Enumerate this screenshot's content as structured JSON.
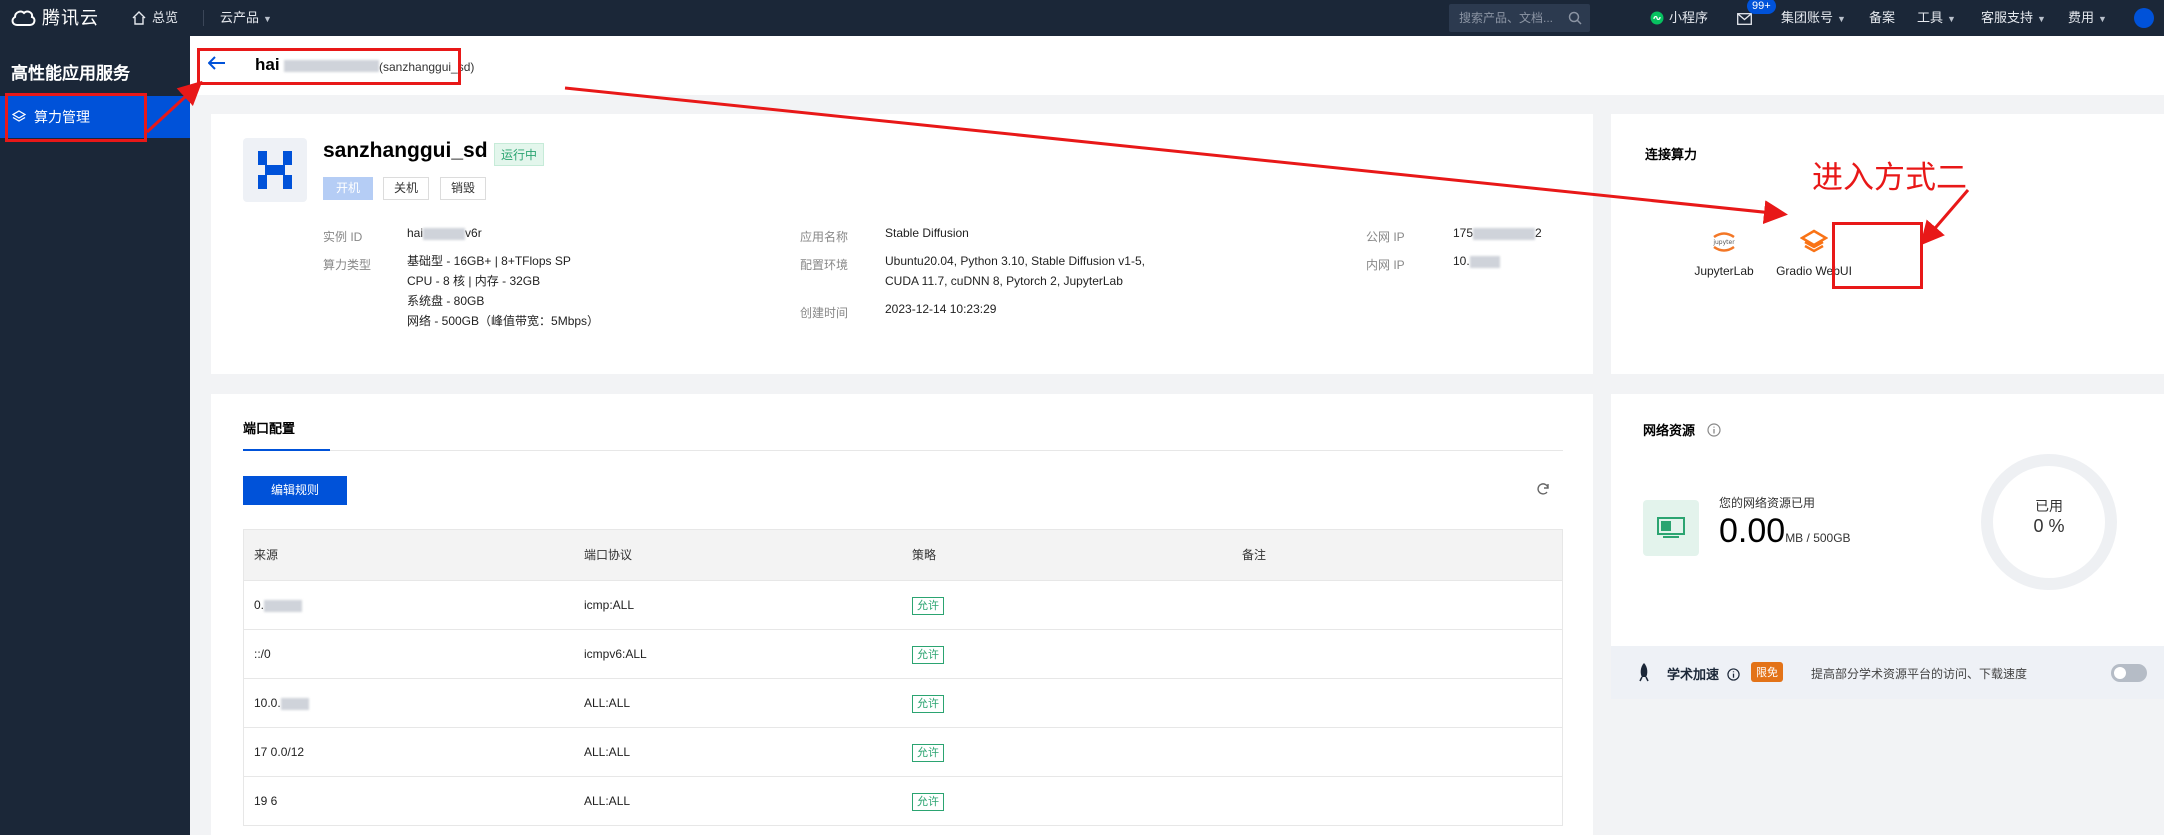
{
  "topbar": {
    "brand": "腾讯云",
    "home": "总览",
    "products": "云产品",
    "search_placeholder": "搜索产品、文档...",
    "mini_program": "小程序",
    "mail_badge": "99+",
    "group_account": "集团账号",
    "beian": "备案",
    "tools": "工具",
    "support": "客服支持",
    "fees": "费用"
  },
  "sidebar": {
    "title": "高性能应用服务",
    "items": [
      {
        "label": "算力管理",
        "active": true
      }
    ]
  },
  "header": {
    "back_icon": "arrow-left-icon",
    "instance_id_partial": "hai",
    "instance_name": "(sanzhanggui_sd)"
  },
  "instance": {
    "title": "sanzhanggui_sd",
    "status": "运行中",
    "actions": {
      "start": "开机",
      "stop": "关机",
      "destroy": "销毁"
    },
    "fields": {
      "id_label": "实例 ID",
      "id_prefix": "hai",
      "id_suffix": "v6r",
      "type_label": "算力类型",
      "type_lines": [
        "基础型 - 16GB+ | 8+TFlops SP",
        "CPU - 8 核 | 内存 - 32GB",
        "系统盘 - 80GB",
        "网络 - 500GB（峰值带宽：5Mbps）"
      ],
      "app_label": "应用名称",
      "app_value": "Stable Diffusion",
      "env_label": "配置环境",
      "env_lines": [
        "Ubuntu20.04, Python 3.10, Stable Diffusion v1-5,",
        "CUDA 11.7, cuDNN 8, Pytorch 2, JupyterLab"
      ],
      "created_label": "创建时间",
      "created_value": "2023-12-14 10:23:29",
      "public_ip_label": "公网 IP",
      "public_ip_prefix": "175",
      "public_ip_suffix": "2",
      "private_ip_label": "内网 IP",
      "private_ip_prefix": "10."
    }
  },
  "connect": {
    "title": "连接算力",
    "items": [
      {
        "label": "JupyterLab",
        "icon": "jupyter-icon"
      },
      {
        "label": "Gradio WebUI",
        "icon": "gradio-icon"
      }
    ],
    "annotation": "进入方式二"
  },
  "ports": {
    "tab": "端口配置",
    "edit_button": "编辑规则",
    "refresh_icon": "refresh-icon",
    "columns": [
      "来源",
      "端口协议",
      "策略",
      "备注"
    ],
    "rows": [
      {
        "source": "0.",
        "protocol": "icmp:ALL",
        "policy": "允许",
        "remark": ""
      },
      {
        "source": "::/0",
        "protocol": "icmpv6:ALL",
        "policy": "允许",
        "remark": ""
      },
      {
        "source": "10.0.",
        "protocol": "ALL:ALL",
        "policy": "允许",
        "remark": ""
      },
      {
        "source": "17 0.0/12",
        "protocol": "ALL:ALL",
        "policy": "允许",
        "remark": ""
      },
      {
        "source": "19 6",
        "protocol": "ALL:ALL",
        "policy": "允许",
        "remark": ""
      }
    ]
  },
  "network": {
    "title": "网络资源",
    "used_label": "您的网络资源已用",
    "used_value": "0.00",
    "used_unit": "MB / 500GB",
    "gauge_label": "已用",
    "gauge_value": "0 %",
    "accel_title": "学术加速",
    "accel_tag": "限免",
    "accel_desc": "提高部分学术资源平台的访问、下载速度",
    "accel_enabled": false
  },
  "colors": {
    "brand": "#0052d9",
    "topbar": "#1b2738",
    "success": "#2ba471",
    "annotation": "#e81818"
  }
}
